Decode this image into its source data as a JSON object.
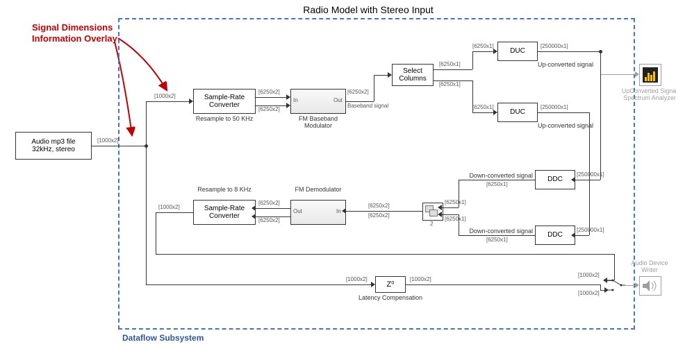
{
  "title": "Radio Model with Stereo Input",
  "annotation": {
    "overlay_line1": "Signal Dimensions",
    "overlay_line2": "Information Overlay",
    "subsystem_label": "Dataflow Subsystem"
  },
  "blocks": {
    "source": {
      "label": "Audio mp3 file\n32kHz, stereo"
    },
    "src1": {
      "label": "Sample-Rate\nConverter",
      "sub": "Resample to 50 KHz"
    },
    "mod": {
      "label": "",
      "sub": "FM Baseband\nModulator",
      "in": "In",
      "out": "Out"
    },
    "selcol": {
      "label": "Select\nColumns"
    },
    "duc1": {
      "label": "DUC",
      "sub": "Up-converted signal"
    },
    "duc2": {
      "label": "DUC",
      "sub": "Up-converted signal"
    },
    "ddc1": {
      "label": "DDC",
      "sub": "Down-converted signal"
    },
    "ddc2": {
      "label": "DDC",
      "sub": "Down-converted signal"
    },
    "src2": {
      "label": "Sample-Rate\nConverter",
      "sub": "Resample to 8 KHz"
    },
    "demod": {
      "label": "",
      "sub": "FM Demodulator",
      "in": "In",
      "out": "Out"
    },
    "concat": {
      "sub": "2"
    },
    "delay": {
      "label": "Z⁰",
      "sub": "Latency Compensation"
    },
    "scope": {
      "sub": "UpConverted Signal\nSpectrum Analyzer"
    },
    "writer": {
      "sub": "Audio Device\nWriter"
    }
  },
  "signals": {
    "s1000x2": "[1000x2]",
    "s6250x2": "[6250x2]",
    "s6250x1": "[6250x1]",
    "s250000x1": "[250000x1]",
    "bb": "Baseband signal"
  },
  "chart_data": {
    "type": "block-diagram",
    "title": "Radio Model with Stereo Input",
    "container": "Dataflow Subsystem (dashed boundary)",
    "nodes": [
      {
        "id": "source",
        "label": "Audio mp3 file 32kHz, stereo",
        "outside_subsystem": true
      },
      {
        "id": "src1",
        "label": "Sample-Rate Converter",
        "note": "Resample to 50 KHz"
      },
      {
        "id": "mod",
        "label": "FM Baseband Modulator",
        "ports": [
          "In",
          "Out"
        ]
      },
      {
        "id": "selcol",
        "label": "Select Columns"
      },
      {
        "id": "duc1",
        "label": "DUC",
        "note": "Up-converted signal"
      },
      {
        "id": "duc2",
        "label": "DUC",
        "note": "Up-converted signal"
      },
      {
        "id": "ddc1",
        "label": "DDC",
        "note": "Down-converted signal"
      },
      {
        "id": "ddc2",
        "label": "DDC",
        "note": "Down-converted signal"
      },
      {
        "id": "concat",
        "label": "Matrix Concatenate (2)"
      },
      {
        "id": "demod",
        "label": "FM Demodulator",
        "ports": [
          "In",
          "Out"
        ]
      },
      {
        "id": "src2",
        "label": "Sample-Rate Converter",
        "note": "Resample to 8 KHz"
      },
      {
        "id": "delay",
        "label": "Z^0",
        "note": "Latency Compensation"
      },
      {
        "id": "switch",
        "label": "Manual Switch"
      },
      {
        "id": "scope",
        "label": "UpConverted Signal Spectrum Analyzer",
        "outside_subsystem": true,
        "commented": true
      },
      {
        "id": "writer",
        "label": "Audio Device Writer",
        "outside_subsystem": true,
        "commented": true
      }
    ],
    "edges": [
      {
        "from": "source",
        "to": "src1",
        "dim": "[1000x2]"
      },
      {
        "from": "src1",
        "to": "mod",
        "dim": "[6250x2]",
        "port": "In"
      },
      {
        "from": "mod",
        "to": "selcol",
        "dim": "[6250x2]",
        "label": "Baseband signal"
      },
      {
        "from": "selcol",
        "to": "duc1",
        "dim": "[6250x1]"
      },
      {
        "from": "selcol",
        "to": "duc2",
        "dim": "[6250x1]"
      },
      {
        "from": "duc1",
        "to": "scope",
        "dim": "[250000x1]",
        "label": "Up-converted signal"
      },
      {
        "from": "duc1",
        "to": "ddc1",
        "dim": "[250000x1]"
      },
      {
        "from": "duc2",
        "to": "ddc2",
        "dim": "[250000x1]"
      },
      {
        "from": "ddc1",
        "to": "concat",
        "dim": "[6250x1]",
        "label": "Down-converted signal"
      },
      {
        "from": "ddc2",
        "to": "concat",
        "dim": "[6250x1]",
        "label": "Down-converted signal"
      },
      {
        "from": "concat",
        "to": "demod",
        "dim": "[6250x2]",
        "port": "In"
      },
      {
        "from": "demod",
        "to": "src2",
        "dim": "[6250x2]",
        "port": "Out"
      },
      {
        "from": "src2",
        "to": "switch",
        "dim": "[1000x2]"
      },
      {
        "from": "source",
        "to": "delay",
        "dim": "[1000x2]",
        "note": "branch of input"
      },
      {
        "from": "delay",
        "to": "switch",
        "dim": "[1000x2]"
      },
      {
        "from": "switch",
        "to": "writer",
        "dim": "[1000x2]"
      }
    ],
    "annotations": [
      {
        "text": "Signal Dimensions Information Overlay",
        "color": "#c00000",
        "points_to": [
          "[1000x2] label near subsystem input",
          "[6250x2] label after Sample-Rate Converter"
        ]
      }
    ]
  }
}
